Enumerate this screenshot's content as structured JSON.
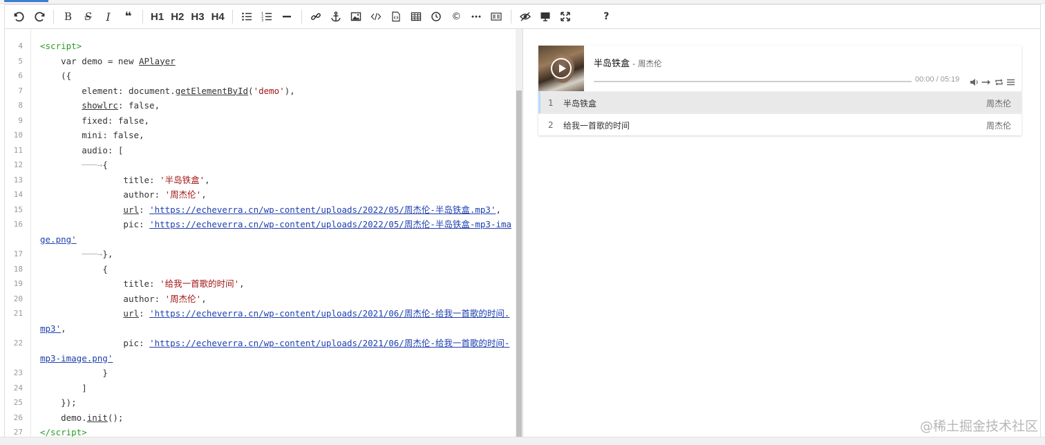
{
  "toolbar": {
    "buttons": [
      {
        "name": "undo-icon",
        "glyph": "↶"
      },
      {
        "name": "redo-icon",
        "glyph": "↷"
      },
      {
        "name": "bold-icon",
        "glyph": "B"
      },
      {
        "name": "strikethrough-icon",
        "glyph": "S"
      },
      {
        "name": "italic-icon",
        "glyph": "I"
      },
      {
        "name": "quote-icon",
        "glyph": "❝"
      }
    ],
    "h1": "H1",
    "h2": "H2",
    "h3": "H3",
    "h4": "H4",
    "help": "?"
  },
  "code_lines": [
    {
      "n": "4",
      "html": "<span class='tag'>&lt;script&gt;</span>"
    },
    {
      "n": "5",
      "html": "    var demo = new <u>APlayer</u>"
    },
    {
      "n": "6",
      "html": "    ({"
    },
    {
      "n": "7",
      "html": "        element: document.<u>getElementById</u>(<span class='str'>'demo'</span>),"
    },
    {
      "n": "8",
      "html": "        <u>showlrc</u>: false,"
    },
    {
      "n": "9",
      "html": "        fixed: false,"
    },
    {
      "n": "10",
      "html": "        mini: false,"
    },
    {
      "n": "11",
      "html": "        audio: ["
    },
    {
      "n": "12",
      "html": "        <span class='tab-arrow'>───→</span>{"
    },
    {
      "n": "13",
      "html": "                title: <span class='str'>'半岛铁盒'</span>,"
    },
    {
      "n": "14",
      "html": "                author: <span class='str'>'周杰伦'</span>,"
    },
    {
      "n": "15",
      "html": "                <u>url</u>: <span class='url'>'https://echeverra.cn/wp-content/uploads/2022/05/周杰伦-半岛铁盒.mp3'</span>,"
    },
    {
      "n": "16",
      "html": "                pic: <span class='url'>'https://echeverra.cn/wp-content/uploads/2022/05/周杰伦-半岛铁盒-mp3-image.png'</span>"
    },
    {
      "n": "17",
      "html": "        <span class='tab-arrow'>───→</span>},"
    },
    {
      "n": "18",
      "html": "            {"
    },
    {
      "n": "19",
      "html": "                title: <span class='str'>'给我一首歌的时间'</span>,"
    },
    {
      "n": "20",
      "html": "                author: <span class='str'>'周杰伦'</span>,"
    },
    {
      "n": "21",
      "html": "                <u>url</u>: <span class='url'>'https://echeverra.cn/wp-content/uploads/2021/06/周杰伦-给我一首歌的时间.mp3'</span>,"
    },
    {
      "n": "22",
      "html": "                pic: <span class='url'>'https://echeverra.cn/wp-content/uploads/2021/06/周杰伦-给我一首歌的时间-mp3-image.png'</span>"
    },
    {
      "n": "23",
      "html": "            }"
    },
    {
      "n": "24",
      "html": "        ]"
    },
    {
      "n": "25",
      "html": "    });"
    },
    {
      "n": "26",
      "html": "    demo.<u>init</u>();"
    },
    {
      "n": "27",
      "html": "<span class='tag'>&lt;/script&gt;</span>"
    }
  ],
  "player": {
    "title": "半岛铁盒",
    "author": "- 周杰伦",
    "time": "00:00 / 05:19",
    "progress": 0,
    "playlist": [
      {
        "index": "1",
        "name": "半岛铁盒",
        "artist": "周杰伦",
        "active": true
      },
      {
        "index": "2",
        "name": "给我一首歌的时间",
        "artist": "周杰伦",
        "active": false
      }
    ]
  },
  "watermark": "@稀土掘金技术社区",
  "colors": {
    "accent": "#3b7fd1",
    "tag": "#2c9a26",
    "string": "#a31515",
    "url": "#1e3fb0",
    "active_border": "#b7daff"
  }
}
